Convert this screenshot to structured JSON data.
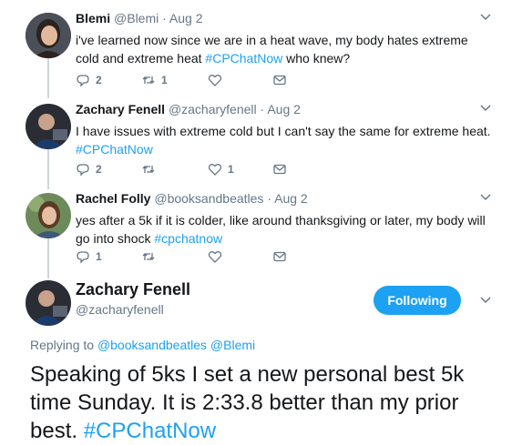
{
  "tweets": [
    {
      "name": "Blemi",
      "handle": "@Blemi",
      "date": "Aug 2",
      "text": "i've learned now since we are in a heat wave, my body hates extreme cold and extreme heat ",
      "hashtag": "#CPChatNow",
      "text_after": " who knew?",
      "replies": "2",
      "retweets": "1",
      "likes": ""
    },
    {
      "name": "Zachary Fenell",
      "handle": "@zacharyfenell",
      "date": "Aug 2",
      "text": "I have issues with extreme cold but I can't say the same for extreme heat. ",
      "hashtag": "#CPChatNow",
      "text_after": "",
      "replies": "2",
      "retweets": "",
      "likes": "1"
    },
    {
      "name": "Rachel Folly",
      "handle": "@booksandbeatles",
      "date": "Aug 2",
      "text": "yes after a 5k if it is colder, like around thanksgiving or later, my body will go into shock ",
      "hashtag": "#cpchatnow",
      "text_after": "",
      "replies": "1",
      "retweets": "",
      "likes": ""
    }
  ],
  "main": {
    "name": "Zachary Fenell",
    "handle": "@zacharyfenell",
    "follow_label": "Following",
    "replying_prefix": "Replying to ",
    "replying_to_1": "@booksandbeatles",
    "replying_to_2": "@Blemi",
    "text": "Speaking of 5ks I set a new personal best 5k time Sunday. It is 2:33.8 better than my prior best. ",
    "hashtag": "#CPChatNow"
  },
  "colors": {
    "accent": "#1da1f2",
    "muted": "#657786",
    "text": "#14171a",
    "line": "#ccd6dd"
  }
}
